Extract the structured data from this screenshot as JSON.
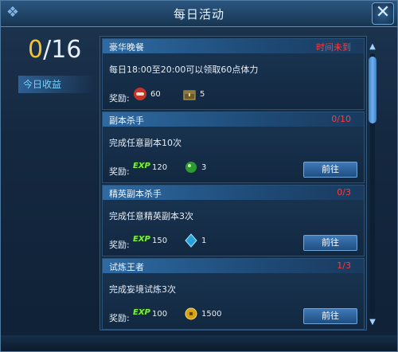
{
  "window": {
    "title": "每日活动"
  },
  "summary": {
    "current": "0",
    "total": "/16",
    "income_label": "今日收益"
  },
  "cards": [
    {
      "title": "豪华晚餐",
      "status": "时间未到",
      "desc": "每日18:00至20:00可以领取60点体力",
      "reward_label": "奖励:",
      "r1": {
        "icon": "meat-icon",
        "value": "60"
      },
      "r2": {
        "icon": "treasure-box-icon",
        "value": "5"
      },
      "button": ""
    },
    {
      "title": "副本杀手",
      "status": "0/10",
      "desc": "完成任意副本10次",
      "reward_label": "奖励:",
      "r1": {
        "icon": "exp-icon",
        "label": "EXP",
        "value": "120"
      },
      "r2": {
        "icon": "green-gem-icon",
        "value": "3"
      },
      "button": "前往"
    },
    {
      "title": "精英副本杀手",
      "status": "0/3",
      "desc": "完成任意精英副本3次",
      "reward_label": "奖励:",
      "r1": {
        "icon": "exp-icon",
        "label": "EXP",
        "value": "150"
      },
      "r2": {
        "icon": "crystal-icon",
        "value": "1"
      },
      "button": "前往"
    },
    {
      "title": "试炼王者",
      "status": "1/3",
      "desc": "完成妄境试炼3次",
      "reward_label": "奖励:",
      "r1": {
        "icon": "exp-icon",
        "label": "EXP",
        "value": "100"
      },
      "r2": {
        "icon": "gold-coin-icon",
        "value": "1500"
      },
      "button": "前往"
    }
  ],
  "colors": {
    "accent": "#2e6aa3",
    "status": "#ff3b3b",
    "counter": "#f2c230"
  }
}
